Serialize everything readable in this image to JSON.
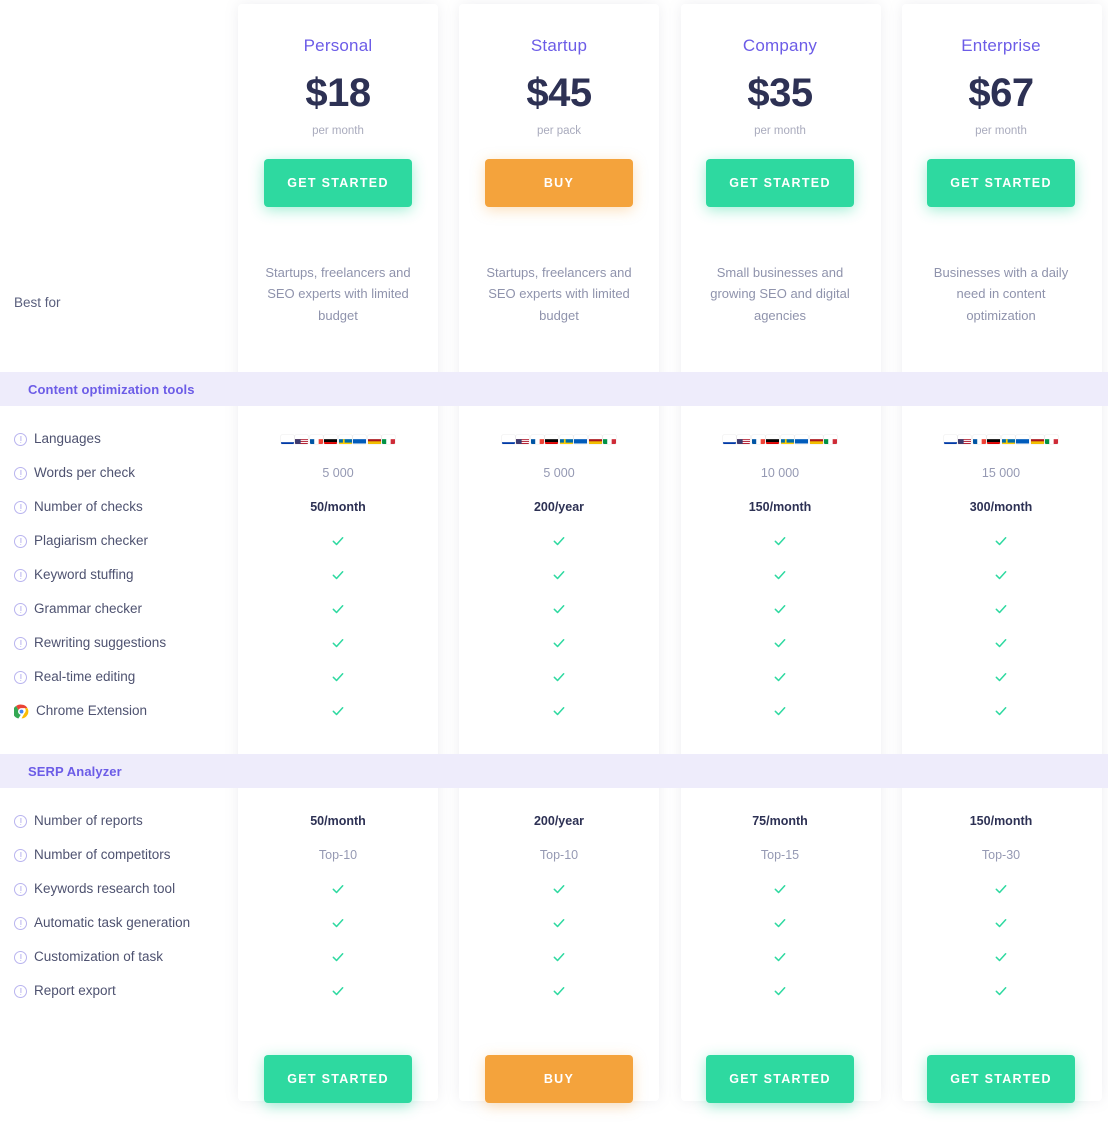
{
  "plans": [
    {
      "name": "Personal",
      "price": "$18",
      "period": "per month",
      "cta": "GET STARTED",
      "cta_style": "green",
      "best_for": "Startups, freelancers and SEO experts with limited budget"
    },
    {
      "name": "Startup",
      "price": "$45",
      "period": "per pack",
      "cta": "BUY",
      "cta_style": "orange",
      "best_for": "Startups, freelancers and SEO experts with limited budget"
    },
    {
      "name": "Company",
      "price": "$35",
      "period": "per month",
      "cta": "GET STARTED",
      "cta_style": "green",
      "best_for": "Small businesses and growing SEO and digital agencies"
    },
    {
      "name": "Enterprise",
      "price": "$67",
      "period": "per month",
      "cta": "GET STARTED",
      "cta_style": "green",
      "best_for": "Businesses with a daily need in content optimization"
    }
  ],
  "best_for_label": "Best for",
  "languages": [
    "Russia",
    "USA",
    "France",
    "Germany",
    "Sweden",
    "Ukraine",
    "Spain",
    "Italy"
  ],
  "sections": [
    {
      "title": "Content optimization tools",
      "rows": [
        {
          "label": "Languages",
          "icon": "info-icon",
          "type": "flags",
          "values": [
            "flags",
            "flags",
            "flags",
            "flags"
          ]
        },
        {
          "label": "Words per check",
          "icon": "info-icon",
          "type": "plain",
          "values": [
            "5 000",
            "5 000",
            "10 000",
            "15 000"
          ]
        },
        {
          "label": "Number of checks",
          "icon": "info-icon",
          "type": "bold",
          "values": [
            "50/month",
            "200/year",
            "150/month",
            "300/month"
          ]
        },
        {
          "label": "Plagiarism checker",
          "icon": "info-icon",
          "type": "check",
          "values": [
            "yes",
            "yes",
            "yes",
            "yes"
          ]
        },
        {
          "label": "Keyword stuffing",
          "icon": "info-icon",
          "type": "check",
          "values": [
            "yes",
            "yes",
            "yes",
            "yes"
          ]
        },
        {
          "label": "Grammar checker",
          "icon": "info-icon",
          "type": "check",
          "values": [
            "yes",
            "yes",
            "yes",
            "yes"
          ]
        },
        {
          "label": "Rewriting suggestions",
          "icon": "info-icon",
          "type": "check",
          "values": [
            "yes",
            "yes",
            "yes",
            "yes"
          ]
        },
        {
          "label": "Real-time editing",
          "icon": "info-icon",
          "type": "check",
          "values": [
            "yes",
            "yes",
            "yes",
            "yes"
          ]
        },
        {
          "label": "Chrome Extension",
          "icon": "chrome-icon",
          "type": "check",
          "values": [
            "yes",
            "yes",
            "yes",
            "yes"
          ]
        }
      ]
    },
    {
      "title": "SERP Analyzer",
      "rows": [
        {
          "label": "Number of reports",
          "icon": "info-icon",
          "type": "bold",
          "values": [
            "50/month",
            "200/year",
            "75/month",
            "150/month"
          ]
        },
        {
          "label": "Number of competitors",
          "icon": "info-icon",
          "type": "plain",
          "values": [
            "Top-10",
            "Top-10",
            "Top-15",
            "Top-30"
          ]
        },
        {
          "label": "Keywords research tool",
          "icon": "info-icon",
          "type": "check",
          "values": [
            "yes",
            "yes",
            "yes",
            "yes"
          ]
        },
        {
          "label": "Automatic task generation",
          "icon": "info-icon",
          "type": "check",
          "values": [
            "yes",
            "yes",
            "yes",
            "yes"
          ]
        },
        {
          "label": "Customization of task",
          "icon": "info-icon",
          "type": "check",
          "values": [
            "yes",
            "yes",
            "yes",
            "yes"
          ]
        },
        {
          "label": "Report export",
          "icon": "info-icon",
          "type": "check",
          "values": [
            "yes",
            "yes",
            "yes",
            "yes"
          ]
        }
      ]
    }
  ],
  "colors": {
    "accent_purple": "#6c5ce7",
    "price_navy": "#2d3154",
    "cta_green": "#2ed9a0",
    "cta_orange": "#f4a33c",
    "check_green": "#2ed9a0",
    "section_bar_bg": "#eeecfb",
    "muted_text": "#9599b3"
  }
}
